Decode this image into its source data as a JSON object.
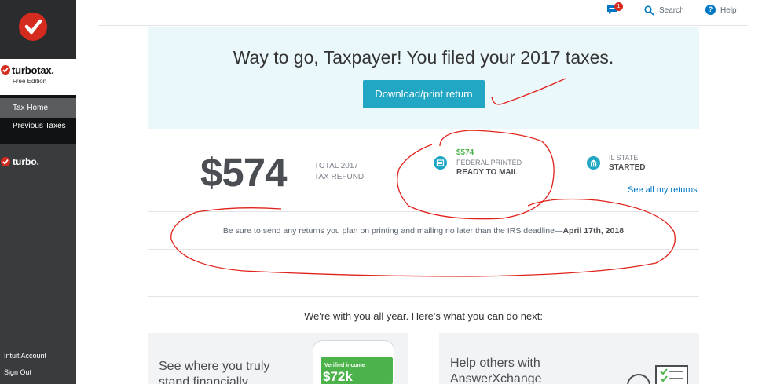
{
  "sidebar": {
    "brand_name": "turbotax.",
    "brand_edition": "Free Edition",
    "nav": [
      "Tax Home",
      "Previous Taxes"
    ],
    "turbo_label": "turbo.",
    "footer": [
      "Intuit Account",
      "Sign Out"
    ]
  },
  "topbar": {
    "notification_count": "1",
    "search_label": "Search",
    "help_label": "Help"
  },
  "hero": {
    "title": "Way to go, Taxpayer! You filed your 2017 taxes.",
    "button_label": "Download/print return"
  },
  "refund": {
    "amount": "$574",
    "label_line1": "TOTAL 2017",
    "label_line2": "TAX REFUND"
  },
  "federal": {
    "amount": "$574",
    "label": "FEDERAL PRINTED",
    "status": "READY TO MAIL"
  },
  "state": {
    "label": "IL STATE",
    "status": "STARTED"
  },
  "see_all_label": "See all my returns",
  "notice": {
    "text": "Be sure to send any returns you plan on printing and mailing no later than the IRS deadline—",
    "deadline": "April 17th, 2018"
  },
  "next_title": "We're with you all year. Here's what you can do next:",
  "cards": {
    "left_line1": "See where you truly",
    "left_line2": "stand financially",
    "phone_label": "Verified income",
    "phone_value": "$72k",
    "right_line1": "Help others with",
    "right_line2": "AnswerXchange"
  },
  "colors": {
    "accent": "#21a6c4",
    "brand_red": "#d52b1e",
    "success": "#4cb34a",
    "link": "#0077c5"
  },
  "icons": [
    "checkmark-logo-icon",
    "chat-icon",
    "search-icon",
    "help-icon",
    "federal-doc-icon",
    "state-building-icon"
  ]
}
